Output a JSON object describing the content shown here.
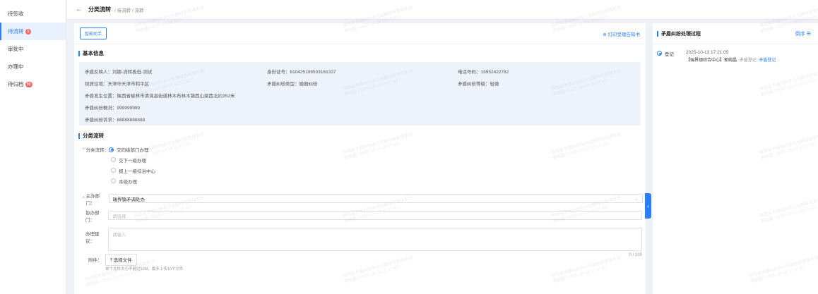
{
  "sidebar": {
    "items": [
      {
        "label": "待签收",
        "badge": ""
      },
      {
        "label": "待流转",
        "badge": "3"
      },
      {
        "label": "审批中",
        "badge": ""
      },
      {
        "label": "办理中",
        "badge": ""
      },
      {
        "label": "待归档",
        "badge": "30"
      }
    ]
  },
  "header": {
    "title": "分类流转",
    "breadcrumb": "/ 待流转 / 流转"
  },
  "toolbar": {
    "assistant_label": "智能助手",
    "print_label": "⊕ 打印受理告知书"
  },
  "basic_info": {
    "section_title": "基本信息",
    "reporter": "矛盾反映人：刘娜-流转极低-测试",
    "id_number": "身份证号：610425199503161337",
    "phone": "电话号码：15952422782",
    "address": "现居住地：天津市天津市和平区",
    "dispute_type": "矛盾纠纷类型：婚姻纠纷",
    "dispute_level": "矛盾纠纷等级：轻微",
    "location": "矛盾发生位置：陕西省榆林市清涧县街道林木布林木镇西山梁西北约352米",
    "overview": "矛盾纠纷概况：999999999",
    "demand": "矛盾纠纷诉求：88888888888"
  },
  "transfer": {
    "section_title": "分类流转",
    "type_label": "分类流转：",
    "options": [
      "交同级部门办理",
      "交下一级办理",
      "报上一级综治中心",
      "本级办理"
    ],
    "selected_option": "交同级部门办理",
    "main_dept_label": "主办部门：",
    "main_dept_value": "瑞界镇矛调处办",
    "assist_dept_label": "协办部门：",
    "assist_dept_placeholder": "请选择",
    "suggestion_label": "办理建议：",
    "suggestion_placeholder": "请输入",
    "char_count": "0 / 100",
    "attachment_label": "附件：",
    "upload_label": "⤒ 选择文件",
    "upload_tip": "单个文件大小不超过10M，最多上传10个文件"
  },
  "process": {
    "title": "矛盾纠纷处理过程",
    "sort_label": "倒序 ☰",
    "events": [
      {
        "step": "登记",
        "time": "2025-10-13 17:21:05",
        "actor": "【瑞界镇综合中心】郭婉晶",
        "action": "矛盾登记",
        "link": "矛盾登记"
      }
    ]
  },
  "watermark": {
    "line1": "陕西省矛盾纠纷多元化解综合管理系统",
    "line2": "郭婉晶 / 2025-10-14 10:17:42 /"
  },
  "colors": {
    "accent": "#2d7ff9",
    "badge": "#f56c6c",
    "info_bg": "#eef3fb"
  }
}
